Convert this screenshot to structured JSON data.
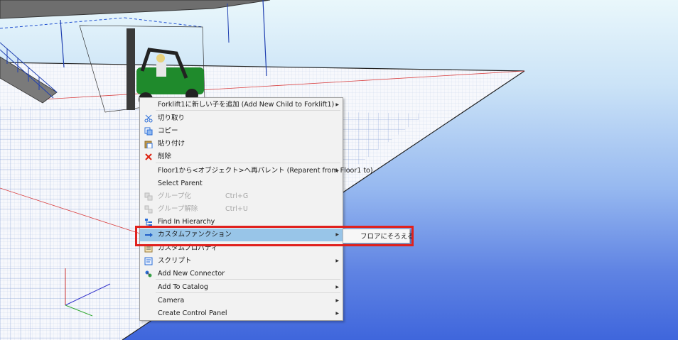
{
  "context_menu": {
    "items": [
      {
        "label": "Forklift1に新しい子を追加 (Add New Child to Forklift1)",
        "icon": "",
        "submenu": true,
        "disabled": false
      },
      {
        "label": "切り取り",
        "icon": "scissors-icon",
        "submenu": false,
        "disabled": false
      },
      {
        "label": "コピー",
        "icon": "copy-icon",
        "submenu": false,
        "disabled": false
      },
      {
        "label": "貼り付け",
        "icon": "paste-icon",
        "submenu": false,
        "disabled": false
      },
      {
        "label": "削除",
        "icon": "delete-x-icon",
        "submenu": false,
        "disabled": false
      },
      {
        "label": "Floor1から<オブジェクト>へ再パレント (Reparent from Floor1 to)",
        "icon": "",
        "submenu": true,
        "disabled": false
      },
      {
        "label": "Select Parent",
        "icon": "",
        "submenu": false,
        "disabled": false
      },
      {
        "label": "グループ化",
        "shortcut": "Ctrl+G",
        "icon": "group-icon",
        "submenu": false,
        "disabled": true
      },
      {
        "label": "グループ解除",
        "shortcut": "Ctrl+U",
        "icon": "ungroup-icon",
        "submenu": false,
        "disabled": true
      },
      {
        "label": "Find In Hierarchy",
        "icon": "hierarchy-icon",
        "submenu": false,
        "disabled": false
      },
      {
        "label": "カスタムファンクション",
        "icon": "arrow-right-icon",
        "submenu": true,
        "disabled": false,
        "highlighted": true
      },
      {
        "label": "カスタムプロパティ",
        "icon": "properties-icon",
        "submenu": false,
        "disabled": false
      },
      {
        "label": "スクリプト",
        "icon": "script-icon",
        "submenu": true,
        "disabled": false
      },
      {
        "label": "Add New Connector",
        "icon": "connector-icon",
        "submenu": false,
        "disabled": false
      },
      {
        "label": "Add To Catalog",
        "icon": "",
        "submenu": true,
        "disabled": false
      },
      {
        "label": "Camera",
        "icon": "",
        "submenu": true,
        "disabled": false
      },
      {
        "label": "Create Control Panel",
        "icon": "",
        "submenu": true,
        "disabled": false
      }
    ]
  },
  "submenu": {
    "label": "フロアにそろえる"
  },
  "colors": {
    "highlight_border": "#e0211d",
    "menu_highlight": "#98c5e8",
    "sky_top": "#e9f7fb",
    "sky_bottom": "#3f66dc"
  }
}
